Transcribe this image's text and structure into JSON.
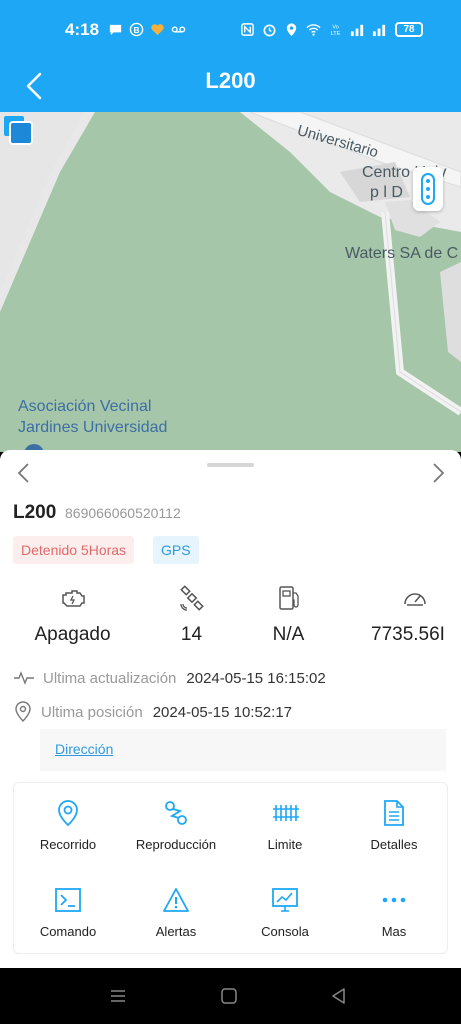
{
  "status_bar": {
    "time": "4:18",
    "battery": "78",
    "icons": [
      "message-icon",
      "b-icon",
      "heart-icon",
      "voicemail-icon",
      "nfc-icon",
      "alarm-icon",
      "location-icon",
      "wifi-icon",
      "volte-icon",
      "signal-icon",
      "signal2-icon"
    ]
  },
  "app_bar": {
    "title": "L200"
  },
  "map": {
    "labels": {
      "street": "Universitario",
      "centro": "Centro Univ",
      "centro2": "p   l D",
      "waters": "Waters SA de C",
      "asoc1": "Asociación Vecinal",
      "asoc2": "Jardines Universidad"
    }
  },
  "vehicle": {
    "name": "L200",
    "imei": "869066060520112",
    "status_tag": "Detenido 5Horas",
    "gps_tag": "GPS"
  },
  "metrics": [
    {
      "icon": "engine-icon",
      "value": "Apagado"
    },
    {
      "icon": "satellite-icon",
      "value": "14"
    },
    {
      "icon": "fuel-icon",
      "value": "N/A"
    },
    {
      "icon": "speedometer-icon",
      "value": "7735.56I"
    }
  ],
  "info": {
    "update_label": "Ultima actualización",
    "update_value": "2024-05-15 16:15:02",
    "position_label": "Ultima posición",
    "position_value": "2024-05-15 10:52:17",
    "address_link": "Dirección"
  },
  "actions": [
    {
      "label": "Recorrido",
      "icon": "location-pin-icon"
    },
    {
      "label": "Reproducción",
      "icon": "route-icon"
    },
    {
      "label": "Limite",
      "icon": "fence-icon"
    },
    {
      "label": "Detalles",
      "icon": "document-icon"
    },
    {
      "label": "Comando",
      "icon": "terminal-icon"
    },
    {
      "label": "Alertas",
      "icon": "warning-icon"
    },
    {
      "label": "Consola",
      "icon": "monitor-icon"
    },
    {
      "label": "Mas",
      "icon": "more-icon"
    }
  ],
  "colors": {
    "primary": "#1ea7f5",
    "map_green": "#a6c6a9",
    "status_red": "#e06a6a",
    "link_blue": "#2e9be0"
  }
}
